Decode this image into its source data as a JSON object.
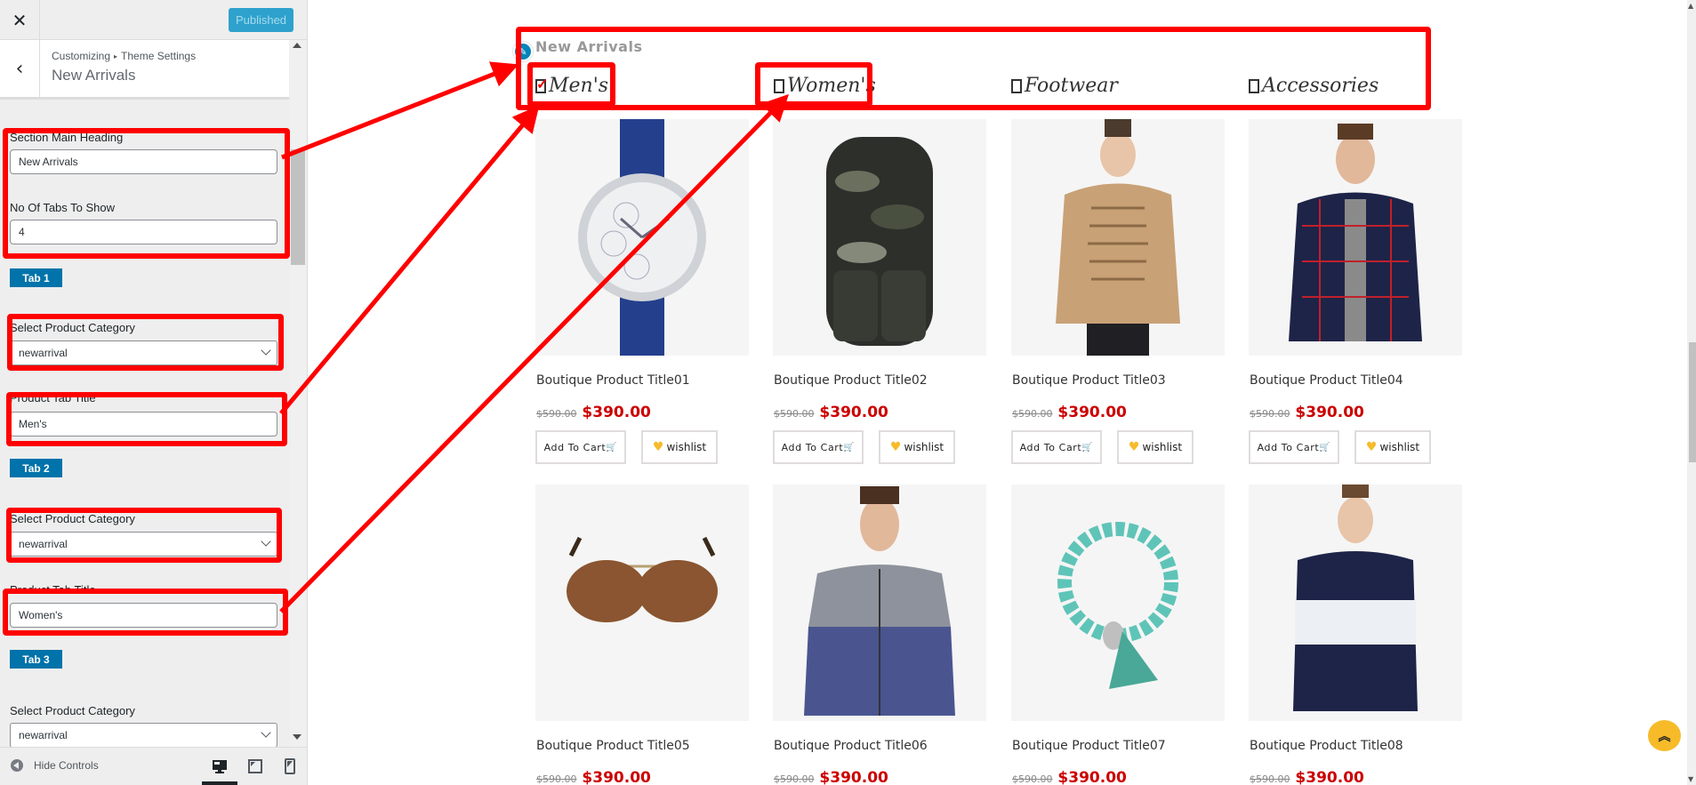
{
  "customizer": {
    "close_icon": "close-icon",
    "publish_label": "Published",
    "breadcrumb": [
      "Customizing",
      "Theme Settings"
    ],
    "section_title": "New Arrivals",
    "fields": {
      "main_heading_label": "Section Main Heading",
      "main_heading_value": "New Arrivals",
      "tabs_count_label": "No Of Tabs To Show",
      "tabs_count_value": "4"
    },
    "tabs": [
      {
        "badge": "Tab 1",
        "category_label": "Select Product Category",
        "category_value": "newarrival",
        "title_label": "Product Tab Title",
        "title_value": "Men's"
      },
      {
        "badge": "Tab 2",
        "category_label": "Select Product Category",
        "category_value": "newarrival",
        "title_label": "Product Tab Title",
        "title_value": "Women's"
      },
      {
        "badge": "Tab 3",
        "category_label": "Select Product Category",
        "category_value": "newarrival"
      }
    ],
    "footer": {
      "hide_controls_label": "Hide Controls",
      "devices": [
        "desktop",
        "tablet",
        "mobile"
      ],
      "active_device": "desktop"
    }
  },
  "preview": {
    "heading": "New Arrivals",
    "tabs": [
      {
        "label": "Men's",
        "checked": true
      },
      {
        "label": "Women's",
        "checked": false
      },
      {
        "label": "Footwear",
        "checked": false
      },
      {
        "label": "Accessories",
        "checked": false
      }
    ],
    "add_to_cart_label": "Add To Cart",
    "wishlist_label": "wishlist",
    "products": [
      {
        "title": "Boutique Product Title01",
        "old_price": "$590.00",
        "price": "$390.00",
        "image": "wristwatch"
      },
      {
        "title": "Boutique Product Title02",
        "old_price": "$590.00",
        "price": "$390.00",
        "image": "camo-backpack"
      },
      {
        "title": "Boutique Product Title03",
        "old_price": "$590.00",
        "price": "$390.00",
        "image": "ruffle-blouse"
      },
      {
        "title": "Boutique Product Title04",
        "old_price": "$590.00",
        "price": "$390.00",
        "image": "plaid-shirt"
      },
      {
        "title": "Boutique Product Title05",
        "old_price": "$590.00",
        "price": "$390.00",
        "image": "aviator-sunglasses"
      },
      {
        "title": "Boutique Product Title06",
        "old_price": "$590.00",
        "price": "$390.00",
        "image": "bomber-jacket"
      },
      {
        "title": "Boutique Product Title07",
        "old_price": "$590.00",
        "price": "$390.00",
        "image": "bead-bracelet"
      },
      {
        "title": "Boutique Product Title08",
        "old_price": "$590.00",
        "price": "$390.00",
        "image": "striped-top"
      }
    ]
  },
  "colors": {
    "annotation": "#ff0000",
    "accent": "#0073aa",
    "sale_price": "#cc0000",
    "back_to_top": "#f7bb2a"
  }
}
